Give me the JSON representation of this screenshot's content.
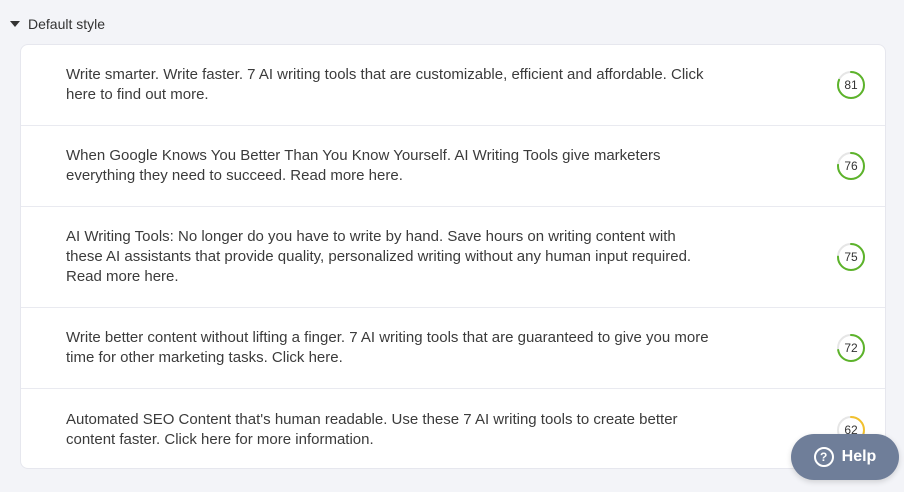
{
  "section": {
    "title": "Default style"
  },
  "rows": [
    {
      "text": "Write smarter. Write faster. 7 AI writing tools that are customizable, efficient and affordable. Click here to find out more.",
      "score": 81,
      "color": "#5cb32a"
    },
    {
      "text": "When Google Knows You Better Than You Know Yourself. AI Writing Tools give marketers everything they need to succeed. Read more here.",
      "score": 76,
      "color": "#5cb32a"
    },
    {
      "text": "AI Writing Tools: No longer do you have to write by hand. Save hours on writing content with these AI assistants that provide quality, personalized writing without any human input required. Read more here.",
      "score": 75,
      "color": "#5cb32a"
    },
    {
      "text": "Write better content without lifting a finger. 7 AI writing tools that are guaranteed to give you more time for other marketing tasks. Click here.",
      "score": 72,
      "color": "#5cb32a"
    },
    {
      "text": "Automated SEO Content that's human readable. Use these 7 AI writing tools to create better content faster. Click here for more information.",
      "score": 62,
      "color": "#f2c12e"
    }
  ],
  "help": {
    "label": "Help",
    "icon": "question-circle-icon"
  }
}
